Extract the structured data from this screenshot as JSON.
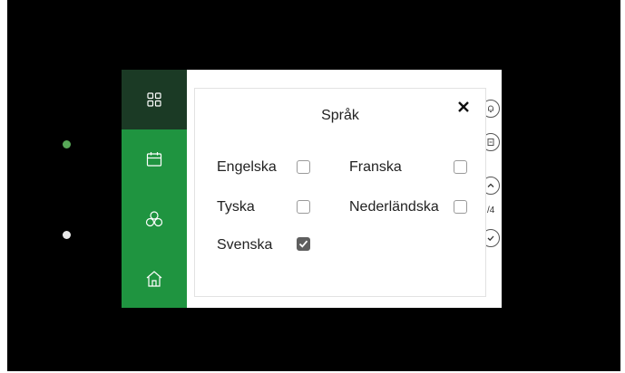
{
  "dialog": {
    "title": "Språk",
    "close_icon": "close-icon",
    "options": [
      {
        "label": "Engelska",
        "checked": false
      },
      {
        "label": "Franska",
        "checked": false
      },
      {
        "label": "Tyska",
        "checked": false
      },
      {
        "label": "Nederländska",
        "checked": false
      },
      {
        "label": "Svenska",
        "checked": true
      }
    ]
  },
  "sidebar": {
    "items": [
      {
        "icon": "apps-grid-icon",
        "active": true
      },
      {
        "icon": "calendar-icon",
        "active": false
      },
      {
        "icon": "fan-icon",
        "active": false
      },
      {
        "icon": "home-icon",
        "active": false
      }
    ]
  },
  "right_panel": {
    "page_indicator": "/4"
  },
  "colors": {
    "sidebar_green": "#1f9440",
    "sidebar_active": "#1b3a25",
    "led_green": "#58a858",
    "checkbox_checked": "#5f5f5f"
  }
}
